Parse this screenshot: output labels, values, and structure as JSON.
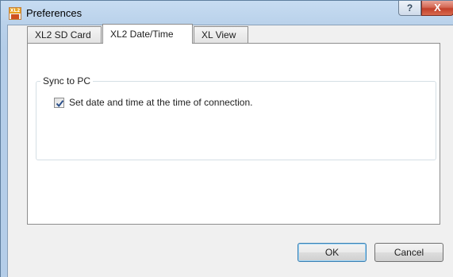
{
  "window": {
    "title": "Preferences",
    "icon": "xl2-app-icon",
    "icon_text": "XL2",
    "help_glyph": "?",
    "close_glyph": "X"
  },
  "tabs": [
    {
      "label": "XL2 SD Card",
      "active": false
    },
    {
      "label": "XL2 Date/Time",
      "active": true
    },
    {
      "label": "XL View",
      "active": false
    }
  ],
  "sync_group": {
    "title": "Sync to PC",
    "checkbox_label": "Set date and time at the time of connection.",
    "checked": true
  },
  "buttons": {
    "ok": "OK",
    "cancel": "Cancel"
  },
  "colors": {
    "title_bar": "#b9d1ea",
    "close_button": "#c2402a",
    "default_button_border": "#3c7fb1"
  }
}
